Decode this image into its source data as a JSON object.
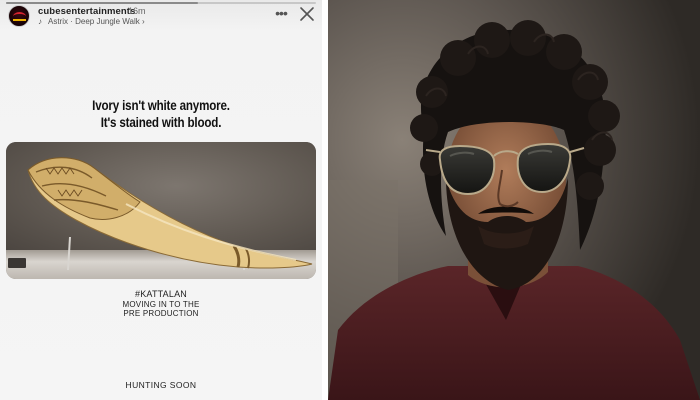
{
  "story": {
    "progress_fraction": 0.62,
    "account_name": "cubesentertainments",
    "time_ago": "16m",
    "music": {
      "icon": "music-note-icon",
      "text": "Astrix · Deep Jungle Walk ›"
    },
    "more_icon": "more-dots-icon",
    "close_icon": "close-icon",
    "headline_line1": "Ivory isn't white anymore.",
    "headline_line2": "It's stained with blood.",
    "image": "ivory-horn-photo",
    "hashtag": "#KATTALAN",
    "caption_line1": "MOVING IN TO THE",
    "caption_line2": "PRE PRODUCTION",
    "footer": "HUNTING SOON"
  },
  "portrait": {
    "image": "bearded-man-sunglasses-photo"
  },
  "colors": {
    "story_background": "#f4f4f4",
    "avatar_background": "#1a0407",
    "text_primary": "#111111",
    "ivory": "#e6c98a"
  }
}
